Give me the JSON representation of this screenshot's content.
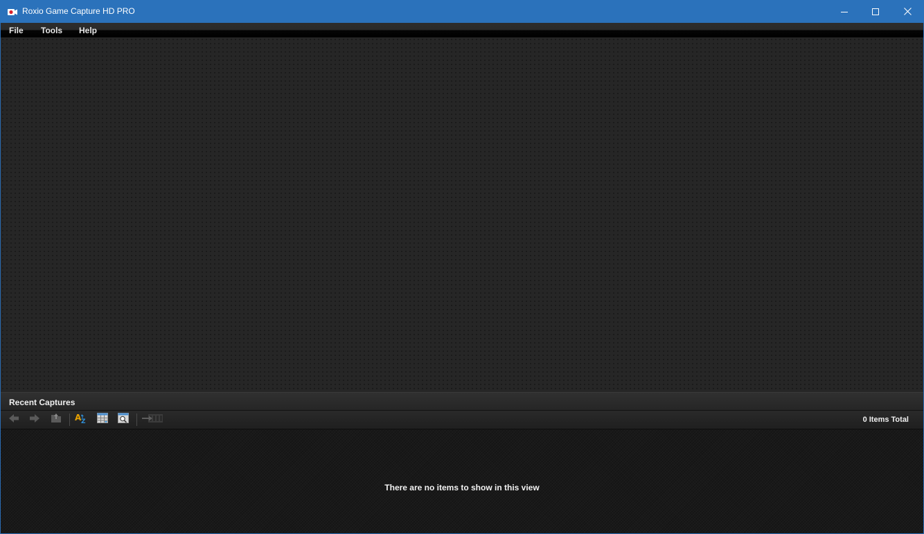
{
  "window": {
    "title": "Roxio Game Capture HD PRO",
    "app_icon": "camcorder-icon",
    "controls": {
      "minimize_icon": "minimize-icon",
      "maximize_icon": "maximize-icon",
      "close_icon": "close-icon"
    }
  },
  "menubar": {
    "items": [
      {
        "label": "File"
      },
      {
        "label": "Tools"
      },
      {
        "label": "Help"
      }
    ]
  },
  "recent_captures": {
    "title": "Recent Captures",
    "toolbar": {
      "buttons": [
        {
          "icon": "back-arrow-icon",
          "enabled": false
        },
        {
          "icon": "forward-arrow-icon",
          "enabled": false
        },
        {
          "icon": "up-folder-icon",
          "enabled": false
        },
        {
          "icon": "sort-az-icon",
          "enabled": true
        },
        {
          "icon": "grid-view-icon",
          "enabled": true
        },
        {
          "icon": "zoom-view-icon",
          "enabled": true
        },
        {
          "icon": "send-to-timeline-icon",
          "enabled": false
        }
      ]
    },
    "items_total": "0 Items Total",
    "empty_message": "There are no items to show in this view"
  },
  "colors": {
    "titlebar": "#2b72bb",
    "main_background": "#262626",
    "accent_orange": "#e8a200"
  }
}
